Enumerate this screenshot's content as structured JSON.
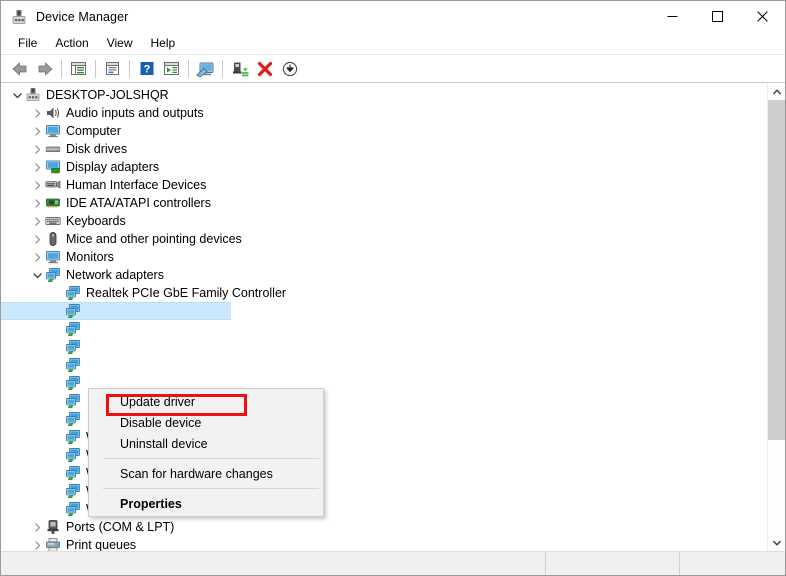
{
  "window": {
    "title": "Device Manager",
    "title_icon": "device-manager-icon",
    "controls": {
      "minimize": "—",
      "maximize": "□",
      "close": "✕"
    }
  },
  "menubar": {
    "items": [
      {
        "label": "File"
      },
      {
        "label": "Action"
      },
      {
        "label": "View"
      },
      {
        "label": "Help"
      }
    ]
  },
  "toolbar": {
    "buttons": [
      {
        "name": "back-icon",
        "title": "Back"
      },
      {
        "name": "forward-icon",
        "title": "Forward"
      },
      {
        "name": "separator-1",
        "title": ""
      },
      {
        "name": "show-hide-console-tree-icon",
        "title": "Show/Hide Console Tree"
      },
      {
        "name": "separator-2",
        "title": ""
      },
      {
        "name": "properties-icon",
        "title": "Properties"
      },
      {
        "name": "separator-3",
        "title": ""
      },
      {
        "name": "help-icon",
        "title": "Help"
      },
      {
        "name": "action-menu-icon",
        "title": "Action"
      },
      {
        "name": "separator-4",
        "title": ""
      },
      {
        "name": "scan-hardware-changes-icon",
        "title": "Scan for hardware changes"
      },
      {
        "name": "separator-5",
        "title": ""
      },
      {
        "name": "update-driver-icon",
        "title": "Update driver"
      },
      {
        "name": "uninstall-device-icon",
        "title": "Uninstall device"
      },
      {
        "name": "disable-device-icon",
        "title": "Disable device"
      }
    ]
  },
  "tree": {
    "nodes": [
      {
        "label": "DESKTOP-JOLSHQR",
        "depth": 0,
        "state": "expanded",
        "icon": "computer-root-icon",
        "selected": false
      },
      {
        "label": "Audio inputs and outputs",
        "depth": 1,
        "state": "collapsed",
        "icon": "speaker-icon",
        "selected": false
      },
      {
        "label": "Computer",
        "depth": 1,
        "state": "collapsed",
        "icon": "monitor-icon",
        "selected": false
      },
      {
        "label": "Disk drives",
        "depth": 1,
        "state": "collapsed",
        "icon": "disk-drive-icon",
        "selected": false
      },
      {
        "label": "Display adapters",
        "depth": 1,
        "state": "collapsed",
        "icon": "display-adapter-icon",
        "selected": false
      },
      {
        "label": "Human Interface Devices",
        "depth": 1,
        "state": "collapsed",
        "icon": "hid-icon",
        "selected": false
      },
      {
        "label": "IDE ATA/ATAPI controllers",
        "depth": 1,
        "state": "collapsed",
        "icon": "ide-controller-icon",
        "selected": false
      },
      {
        "label": "Keyboards",
        "depth": 1,
        "state": "collapsed",
        "icon": "keyboard-icon",
        "selected": false
      },
      {
        "label": "Mice and other pointing devices",
        "depth": 1,
        "state": "collapsed",
        "icon": "mouse-icon",
        "selected": false
      },
      {
        "label": "Monitors",
        "depth": 1,
        "state": "collapsed",
        "icon": "monitor-icon",
        "selected": false
      },
      {
        "label": "Network adapters",
        "depth": 1,
        "state": "expanded",
        "icon": "network-adapter-icon",
        "selected": false
      },
      {
        "label": "Realtek PCIe GbE Family Controller",
        "depth": 2,
        "state": "leaf",
        "icon": "network-adapter-icon",
        "selected": false
      },
      {
        "label": "",
        "depth": 2,
        "state": "leaf",
        "icon": "network-adapter-icon",
        "selected": true
      },
      {
        "label": "",
        "depth": 2,
        "state": "leaf",
        "icon": "network-adapter-icon",
        "selected": false
      },
      {
        "label": "",
        "depth": 2,
        "state": "leaf",
        "icon": "network-adapter-icon",
        "selected": false
      },
      {
        "label": "",
        "depth": 2,
        "state": "leaf",
        "icon": "network-adapter-icon",
        "selected": false
      },
      {
        "label": "",
        "depth": 2,
        "state": "leaf",
        "icon": "network-adapter-icon",
        "selected": false
      },
      {
        "label": "",
        "depth": 2,
        "state": "leaf",
        "icon": "network-adapter-icon",
        "selected": false
      },
      {
        "label": "",
        "depth": 2,
        "state": "leaf",
        "icon": "network-adapter-icon",
        "selected": false
      },
      {
        "label": "WAN Miniport (Network Monitor)",
        "depth": 2,
        "state": "leaf",
        "icon": "network-adapter-icon",
        "selected": false
      },
      {
        "label": "WAN Miniport (PPPOE)",
        "depth": 2,
        "state": "leaf",
        "icon": "network-adapter-icon",
        "selected": false
      },
      {
        "label": "WAN Miniport (PPTP)",
        "depth": 2,
        "state": "leaf",
        "icon": "network-adapter-icon",
        "selected": false
      },
      {
        "label": "WAN Miniport (SSTP)",
        "depth": 2,
        "state": "leaf",
        "icon": "network-adapter-icon",
        "selected": false
      },
      {
        "label": "Wintun Userspace Tunnel",
        "depth": 2,
        "state": "leaf",
        "icon": "network-adapter-icon",
        "selected": false
      },
      {
        "label": "Ports (COM & LPT)",
        "depth": 1,
        "state": "collapsed",
        "icon": "port-icon",
        "selected": false
      },
      {
        "label": "Print queues",
        "depth": 1,
        "state": "collapsed",
        "icon": "printer-icon",
        "selected": false
      }
    ]
  },
  "context_menu": {
    "items": [
      {
        "label": "Update driver",
        "type": "item",
        "bold": false,
        "highlighted": true
      },
      {
        "label": "Disable device",
        "type": "item",
        "bold": false,
        "highlighted": false
      },
      {
        "label": "Uninstall device",
        "type": "item",
        "bold": false,
        "highlighted": false
      },
      {
        "label": "",
        "type": "separator",
        "bold": false,
        "highlighted": false
      },
      {
        "label": "Scan for hardware changes",
        "type": "item",
        "bold": false,
        "highlighted": false
      },
      {
        "label": "",
        "type": "separator",
        "bold": false,
        "highlighted": false
      },
      {
        "label": "Properties",
        "type": "item",
        "bold": true,
        "highlighted": false
      }
    ]
  },
  "annotation": {
    "highlight_color": "#ee1111",
    "target": "Update driver"
  },
  "statusbar": {
    "pane1": "",
    "pane2": "",
    "pane3": ""
  },
  "scrollbar": {
    "up_arrow": "▲",
    "down_arrow": "▼"
  }
}
